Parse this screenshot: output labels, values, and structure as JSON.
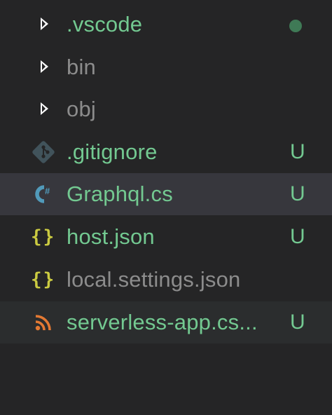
{
  "explorer": {
    "items": [
      {
        "label": ".vscode",
        "icon": "folder-chevron-right-icon",
        "status": "modified-dot",
        "color": "#73c991"
      },
      {
        "label": "bin",
        "icon": "folder-chevron-right-icon",
        "status": "",
        "color": "#8c8c8c"
      },
      {
        "label": "obj",
        "icon": "folder-chevron-right-icon",
        "status": "",
        "color": "#8c8c8c"
      },
      {
        "label": ".gitignore",
        "icon": "git-icon",
        "status": "U",
        "color": "#73c991"
      },
      {
        "label": "Graphql.cs",
        "icon": "csharp-icon",
        "status": "U",
        "color": "#73c991",
        "selected": true
      },
      {
        "label": "host.json",
        "icon": "json-braces-icon",
        "status": "U",
        "color": "#73c991"
      },
      {
        "label": "local.settings.json",
        "icon": "json-braces-icon",
        "status": "",
        "color": "#8c8c8c"
      },
      {
        "label": "serverless-app.cs...",
        "icon": "rss-feed-icon",
        "status": "U",
        "color": "#73c991"
      }
    ],
    "icon_colors": {
      "git": "#41535b",
      "csharp": "#519aba",
      "json": "#cbcb41",
      "rss": "#e37933"
    },
    "badge_color": "#73c991"
  }
}
